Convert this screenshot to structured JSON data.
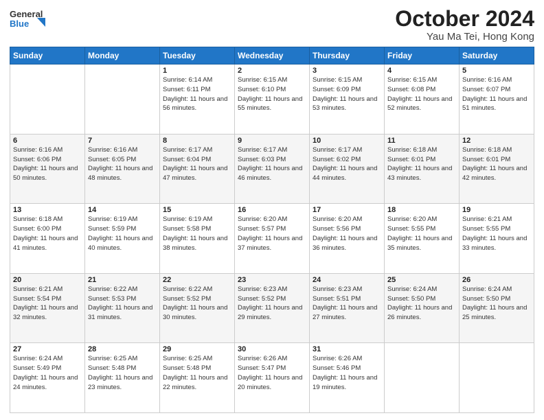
{
  "logo": {
    "line1": "General",
    "line2": "Blue"
  },
  "title": "October 2024",
  "location": "Yau Ma Tei, Hong Kong",
  "weekdays": [
    "Sunday",
    "Monday",
    "Tuesday",
    "Wednesday",
    "Thursday",
    "Friday",
    "Saturday"
  ],
  "weeks": [
    [
      {
        "day": "",
        "sunrise": "",
        "sunset": "",
        "daylight": ""
      },
      {
        "day": "",
        "sunrise": "",
        "sunset": "",
        "daylight": ""
      },
      {
        "day": "1",
        "sunrise": "Sunrise: 6:14 AM",
        "sunset": "Sunset: 6:11 PM",
        "daylight": "Daylight: 11 hours and 56 minutes."
      },
      {
        "day": "2",
        "sunrise": "Sunrise: 6:15 AM",
        "sunset": "Sunset: 6:10 PM",
        "daylight": "Daylight: 11 hours and 55 minutes."
      },
      {
        "day": "3",
        "sunrise": "Sunrise: 6:15 AM",
        "sunset": "Sunset: 6:09 PM",
        "daylight": "Daylight: 11 hours and 53 minutes."
      },
      {
        "day": "4",
        "sunrise": "Sunrise: 6:15 AM",
        "sunset": "Sunset: 6:08 PM",
        "daylight": "Daylight: 11 hours and 52 minutes."
      },
      {
        "day": "5",
        "sunrise": "Sunrise: 6:16 AM",
        "sunset": "Sunset: 6:07 PM",
        "daylight": "Daylight: 11 hours and 51 minutes."
      }
    ],
    [
      {
        "day": "6",
        "sunrise": "Sunrise: 6:16 AM",
        "sunset": "Sunset: 6:06 PM",
        "daylight": "Daylight: 11 hours and 50 minutes."
      },
      {
        "day": "7",
        "sunrise": "Sunrise: 6:16 AM",
        "sunset": "Sunset: 6:05 PM",
        "daylight": "Daylight: 11 hours and 48 minutes."
      },
      {
        "day": "8",
        "sunrise": "Sunrise: 6:17 AM",
        "sunset": "Sunset: 6:04 PM",
        "daylight": "Daylight: 11 hours and 47 minutes."
      },
      {
        "day": "9",
        "sunrise": "Sunrise: 6:17 AM",
        "sunset": "Sunset: 6:03 PM",
        "daylight": "Daylight: 11 hours and 46 minutes."
      },
      {
        "day": "10",
        "sunrise": "Sunrise: 6:17 AM",
        "sunset": "Sunset: 6:02 PM",
        "daylight": "Daylight: 11 hours and 44 minutes."
      },
      {
        "day": "11",
        "sunrise": "Sunrise: 6:18 AM",
        "sunset": "Sunset: 6:01 PM",
        "daylight": "Daylight: 11 hours and 43 minutes."
      },
      {
        "day": "12",
        "sunrise": "Sunrise: 6:18 AM",
        "sunset": "Sunset: 6:01 PM",
        "daylight": "Daylight: 11 hours and 42 minutes."
      }
    ],
    [
      {
        "day": "13",
        "sunrise": "Sunrise: 6:18 AM",
        "sunset": "Sunset: 6:00 PM",
        "daylight": "Daylight: 11 hours and 41 minutes."
      },
      {
        "day": "14",
        "sunrise": "Sunrise: 6:19 AM",
        "sunset": "Sunset: 5:59 PM",
        "daylight": "Daylight: 11 hours and 40 minutes."
      },
      {
        "day": "15",
        "sunrise": "Sunrise: 6:19 AM",
        "sunset": "Sunset: 5:58 PM",
        "daylight": "Daylight: 11 hours and 38 minutes."
      },
      {
        "day": "16",
        "sunrise": "Sunrise: 6:20 AM",
        "sunset": "Sunset: 5:57 PM",
        "daylight": "Daylight: 11 hours and 37 minutes."
      },
      {
        "day": "17",
        "sunrise": "Sunrise: 6:20 AM",
        "sunset": "Sunset: 5:56 PM",
        "daylight": "Daylight: 11 hours and 36 minutes."
      },
      {
        "day": "18",
        "sunrise": "Sunrise: 6:20 AM",
        "sunset": "Sunset: 5:55 PM",
        "daylight": "Daylight: 11 hours and 35 minutes."
      },
      {
        "day": "19",
        "sunrise": "Sunrise: 6:21 AM",
        "sunset": "Sunset: 5:55 PM",
        "daylight": "Daylight: 11 hours and 33 minutes."
      }
    ],
    [
      {
        "day": "20",
        "sunrise": "Sunrise: 6:21 AM",
        "sunset": "Sunset: 5:54 PM",
        "daylight": "Daylight: 11 hours and 32 minutes."
      },
      {
        "day": "21",
        "sunrise": "Sunrise: 6:22 AM",
        "sunset": "Sunset: 5:53 PM",
        "daylight": "Daylight: 11 hours and 31 minutes."
      },
      {
        "day": "22",
        "sunrise": "Sunrise: 6:22 AM",
        "sunset": "Sunset: 5:52 PM",
        "daylight": "Daylight: 11 hours and 30 minutes."
      },
      {
        "day": "23",
        "sunrise": "Sunrise: 6:23 AM",
        "sunset": "Sunset: 5:52 PM",
        "daylight": "Daylight: 11 hours and 29 minutes."
      },
      {
        "day": "24",
        "sunrise": "Sunrise: 6:23 AM",
        "sunset": "Sunset: 5:51 PM",
        "daylight": "Daylight: 11 hours and 27 minutes."
      },
      {
        "day": "25",
        "sunrise": "Sunrise: 6:24 AM",
        "sunset": "Sunset: 5:50 PM",
        "daylight": "Daylight: 11 hours and 26 minutes."
      },
      {
        "day": "26",
        "sunrise": "Sunrise: 6:24 AM",
        "sunset": "Sunset: 5:50 PM",
        "daylight": "Daylight: 11 hours and 25 minutes."
      }
    ],
    [
      {
        "day": "27",
        "sunrise": "Sunrise: 6:24 AM",
        "sunset": "Sunset: 5:49 PM",
        "daylight": "Daylight: 11 hours and 24 minutes."
      },
      {
        "day": "28",
        "sunrise": "Sunrise: 6:25 AM",
        "sunset": "Sunset: 5:48 PM",
        "daylight": "Daylight: 11 hours and 23 minutes."
      },
      {
        "day": "29",
        "sunrise": "Sunrise: 6:25 AM",
        "sunset": "Sunset: 5:48 PM",
        "daylight": "Daylight: 11 hours and 22 minutes."
      },
      {
        "day": "30",
        "sunrise": "Sunrise: 6:26 AM",
        "sunset": "Sunset: 5:47 PM",
        "daylight": "Daylight: 11 hours and 20 minutes."
      },
      {
        "day": "31",
        "sunrise": "Sunrise: 6:26 AM",
        "sunset": "Sunset: 5:46 PM",
        "daylight": "Daylight: 11 hours and 19 minutes."
      },
      {
        "day": "",
        "sunrise": "",
        "sunset": "",
        "daylight": ""
      },
      {
        "day": "",
        "sunrise": "",
        "sunset": "",
        "daylight": ""
      }
    ]
  ]
}
